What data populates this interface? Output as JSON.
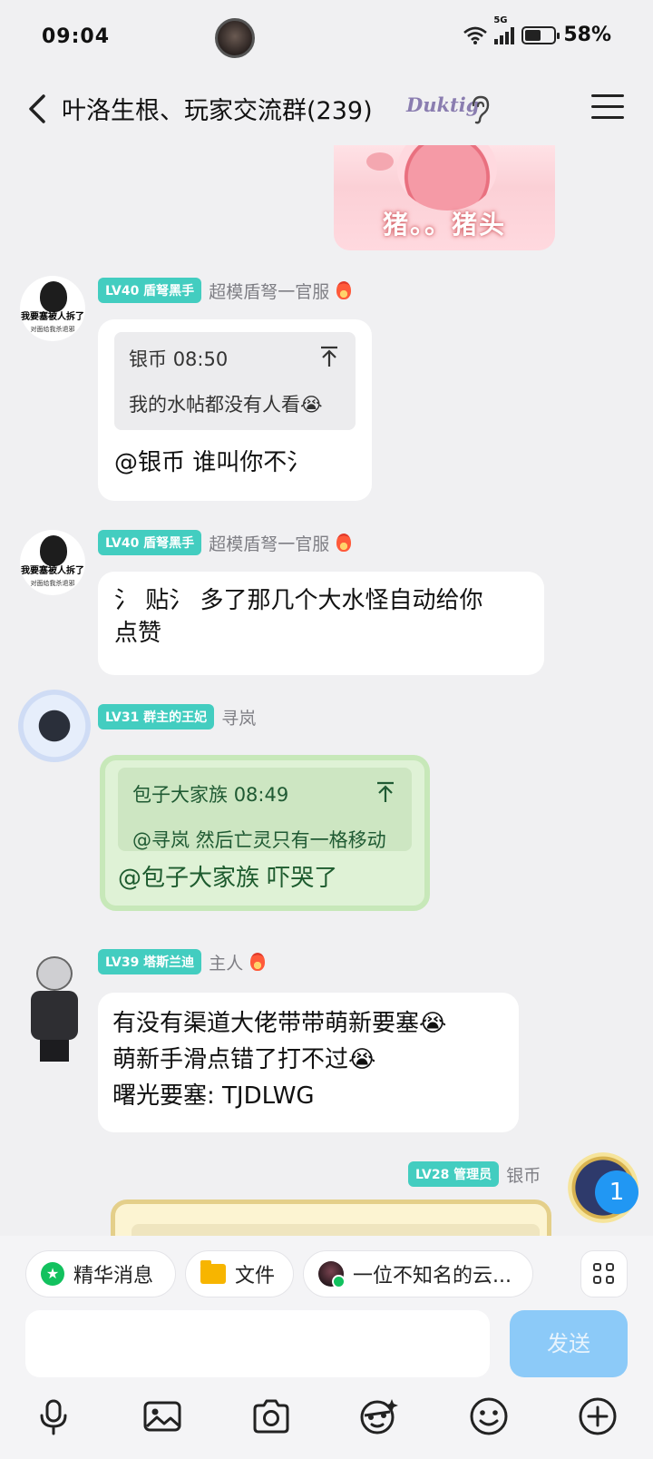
{
  "status_bar": {
    "time": "09:04",
    "network": "5G",
    "battery": "58%",
    "battery_level": 0.58
  },
  "header": {
    "back_icon": "chevron-left-icon",
    "title": "叶洛生根、玩家交流群(239)",
    "title_badge": "Duktig",
    "ear_icon": "ear-icon",
    "menu_icon": "hamburger-menu-icon"
  },
  "messages": [
    {
      "level": "LV40 盾弩黑手",
      "name": "超模盾弩一官服",
      "avatar_text": "我要塞被人拆了",
      "avatar_subtext": "对面给我杀退邪",
      "quote_author": "银币",
      "quote_time": "08:50",
      "quote_text": "我的水帖都没有人看😭",
      "text": "@银币 谁叫你不氵"
    },
    {
      "level": "LV40 盾弩黑手",
      "name": "超模盾弩一官服",
      "avatar_text": "我要塞被人拆了",
      "avatar_subtext": "对面给我杀退邪",
      "text_lines": [
        "氵 贴氵 多了那几个大水怪自动给你",
        "点赞"
      ]
    },
    {
      "level": "LV31 群主的王妃",
      "name": "寻岚",
      "quote_author": "包子大家族",
      "quote_time": "08:49",
      "quote_text": "@寻岚 然后亡灵只有一格移动",
      "text": "@包子大家族 吓哭了"
    },
    {
      "level": "LV39 塔斯兰迪",
      "name": "主人",
      "text_lines": [
        "有没有渠道大佬带带萌新要塞😭",
        "萌新手滑点错了打不过😭",
        "曙光要塞: TJDLWG"
      ]
    },
    {
      "level": "LV28 管理员",
      "name": "银币"
    }
  ],
  "sticker_text": "猪。。猪头",
  "unread_badge": "1",
  "bottom": {
    "chips": [
      "精华消息",
      "文件",
      "一位不知名的云..."
    ],
    "send_label": "发送",
    "input_placeholder": "",
    "toolbar": [
      "microphone-icon",
      "image-icon",
      "camera-icon",
      "sticker-face-icon",
      "emoji-icon",
      "plus-icon"
    ]
  },
  "colors": {
    "level_badge": "#43cdc0",
    "send_button": "#8ccaf8",
    "unread_badge": "#2197f3",
    "background": "#f0f0f2"
  }
}
